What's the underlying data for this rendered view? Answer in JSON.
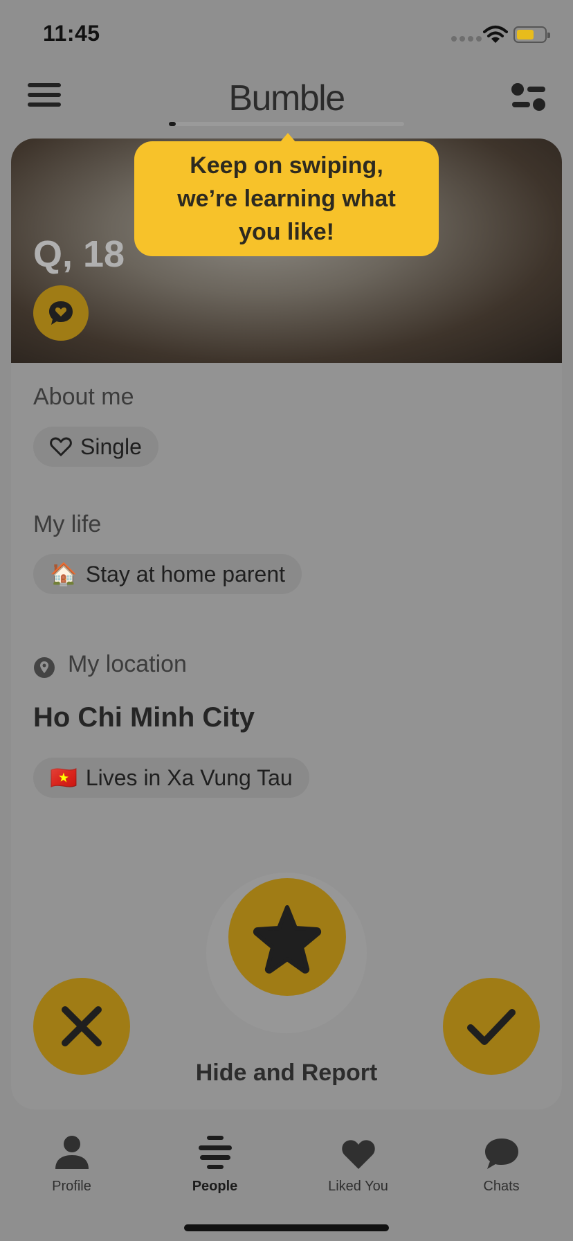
{
  "status_bar": {
    "time": "11:45"
  },
  "header": {
    "title": "Bumble",
    "progress": 0.03
  },
  "tooltip": {
    "line1": "Keep on swiping,",
    "line2": "we’re learning what",
    "line3": "you like!"
  },
  "profile": {
    "name_age": "Q, 18",
    "about_heading": "About me",
    "about_chip": "Single",
    "life_heading": "My life",
    "life_chip_emoji": "🏠",
    "life_chip": "Stay at home parent",
    "location_heading": "My location",
    "city": "Ho Chi Minh City",
    "lives_in_flag": "🇻🇳",
    "lives_in": "Lives in Xa Vung Tau"
  },
  "actions": {
    "hide_report": "Hide and Report"
  },
  "tabs": [
    {
      "label": "Profile",
      "icon": "person-icon"
    },
    {
      "label": "People",
      "icon": "people-icon",
      "active": true
    },
    {
      "label": "Liked You",
      "icon": "heart-icon"
    },
    {
      "label": "Chats",
      "icon": "chat-icon"
    }
  ],
  "colors": {
    "accent": "#a07c15",
    "tooltip": "#f7c22a",
    "background": "#8f8f8f"
  }
}
